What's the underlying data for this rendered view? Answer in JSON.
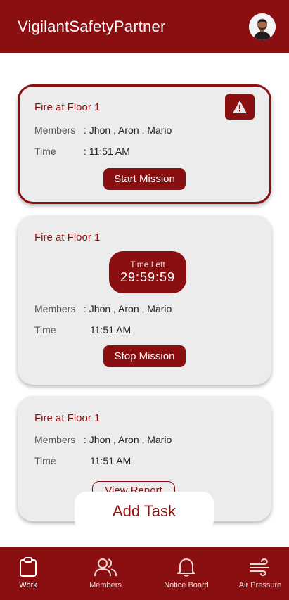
{
  "header": {
    "title": "VigilantSafetyPartner"
  },
  "colors": {
    "primary": "#8a0f10",
    "card_bg": "#ececec",
    "text_muted": "#555555"
  },
  "cards": [
    {
      "title": "Fire at Floor 1",
      "members_label": "Members",
      "members_value": ": Jhon , Aron , Mario",
      "time_label": "Time",
      "time_value": ": 11:51 AM",
      "action_label": "Start Mission",
      "icon": "warning-triangle-icon"
    },
    {
      "title": "Fire at Floor 1",
      "timer_label": "Time Left",
      "timer_value": "29:59:59",
      "members_label": "Members",
      "members_value": ": Jhon , Aron , Mario",
      "time_label": "Time",
      "time_value": "11:51 AM",
      "action_label": "Stop Mission"
    },
    {
      "title": "Fire at Floor 1",
      "members_label": "Members",
      "members_value": ": Jhon , Aron , Mario",
      "time_label": "Time",
      "time_value": "11:51 AM",
      "action_label": "View Report"
    }
  ],
  "add_task_label": "Add Task",
  "nav": [
    {
      "label": "Work",
      "icon": "clipboard-icon",
      "active": true
    },
    {
      "label": "Members",
      "icon": "members-icon"
    },
    {
      "label": "Notice Board",
      "icon": "bell-icon"
    },
    {
      "label": "Air Pressure",
      "icon": "wind-icon"
    }
  ]
}
